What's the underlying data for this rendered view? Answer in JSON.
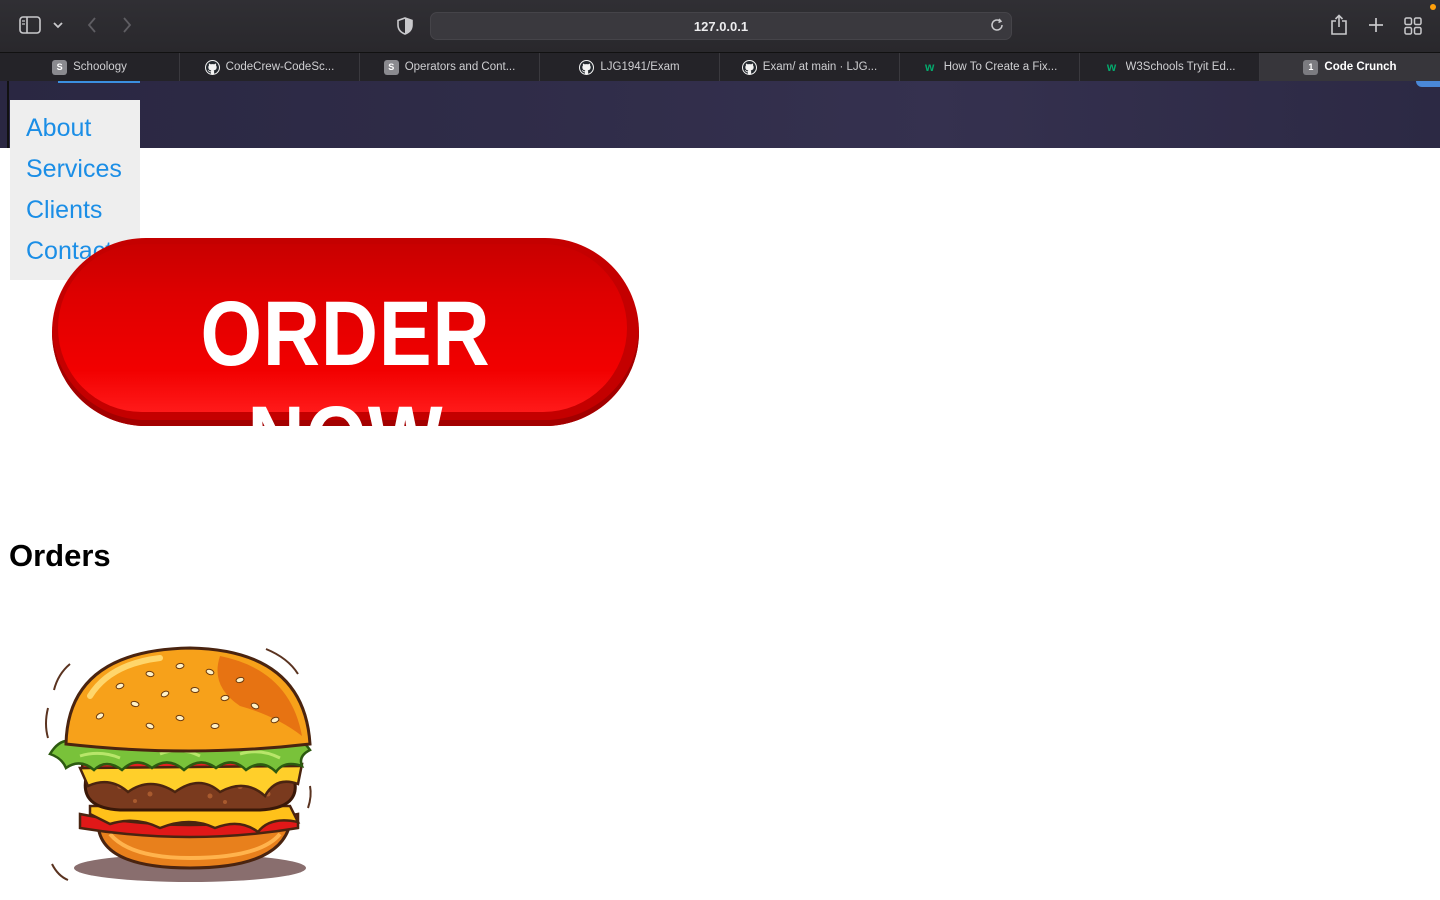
{
  "browser": {
    "address": "127.0.0.1",
    "tabs": [
      {
        "label": "Schoology",
        "favicon": "S",
        "favicon_type": "schoology"
      },
      {
        "label": "CodeCrew-CodeSc...",
        "favicon": "",
        "favicon_type": "github"
      },
      {
        "label": "Operators and Cont...",
        "favicon": "S",
        "favicon_type": "schoology"
      },
      {
        "label": "LJG1941/Exam",
        "favicon": "",
        "favicon_type": "github"
      },
      {
        "label": "Exam/ at main · LJG...",
        "favicon": "",
        "favicon_type": "github"
      },
      {
        "label": "How To Create a Fix...",
        "favicon": "w",
        "favicon_type": "w3schools"
      },
      {
        "label": "W3Schools Tryit Ed...",
        "favicon": "w",
        "favicon_type": "w3schools"
      },
      {
        "label": "Code Crunch",
        "favicon": "1",
        "favicon_type": "number",
        "active": true
      }
    ]
  },
  "nav": {
    "items": [
      "About",
      "Services",
      "Clients",
      "Contact"
    ]
  },
  "order_button": {
    "label": "ORDER NOW"
  },
  "orders": {
    "heading": "Orders"
  },
  "colors": {
    "link": "#1b8ee6",
    "order_red": "#e00000",
    "banner": "#2f2c48"
  }
}
